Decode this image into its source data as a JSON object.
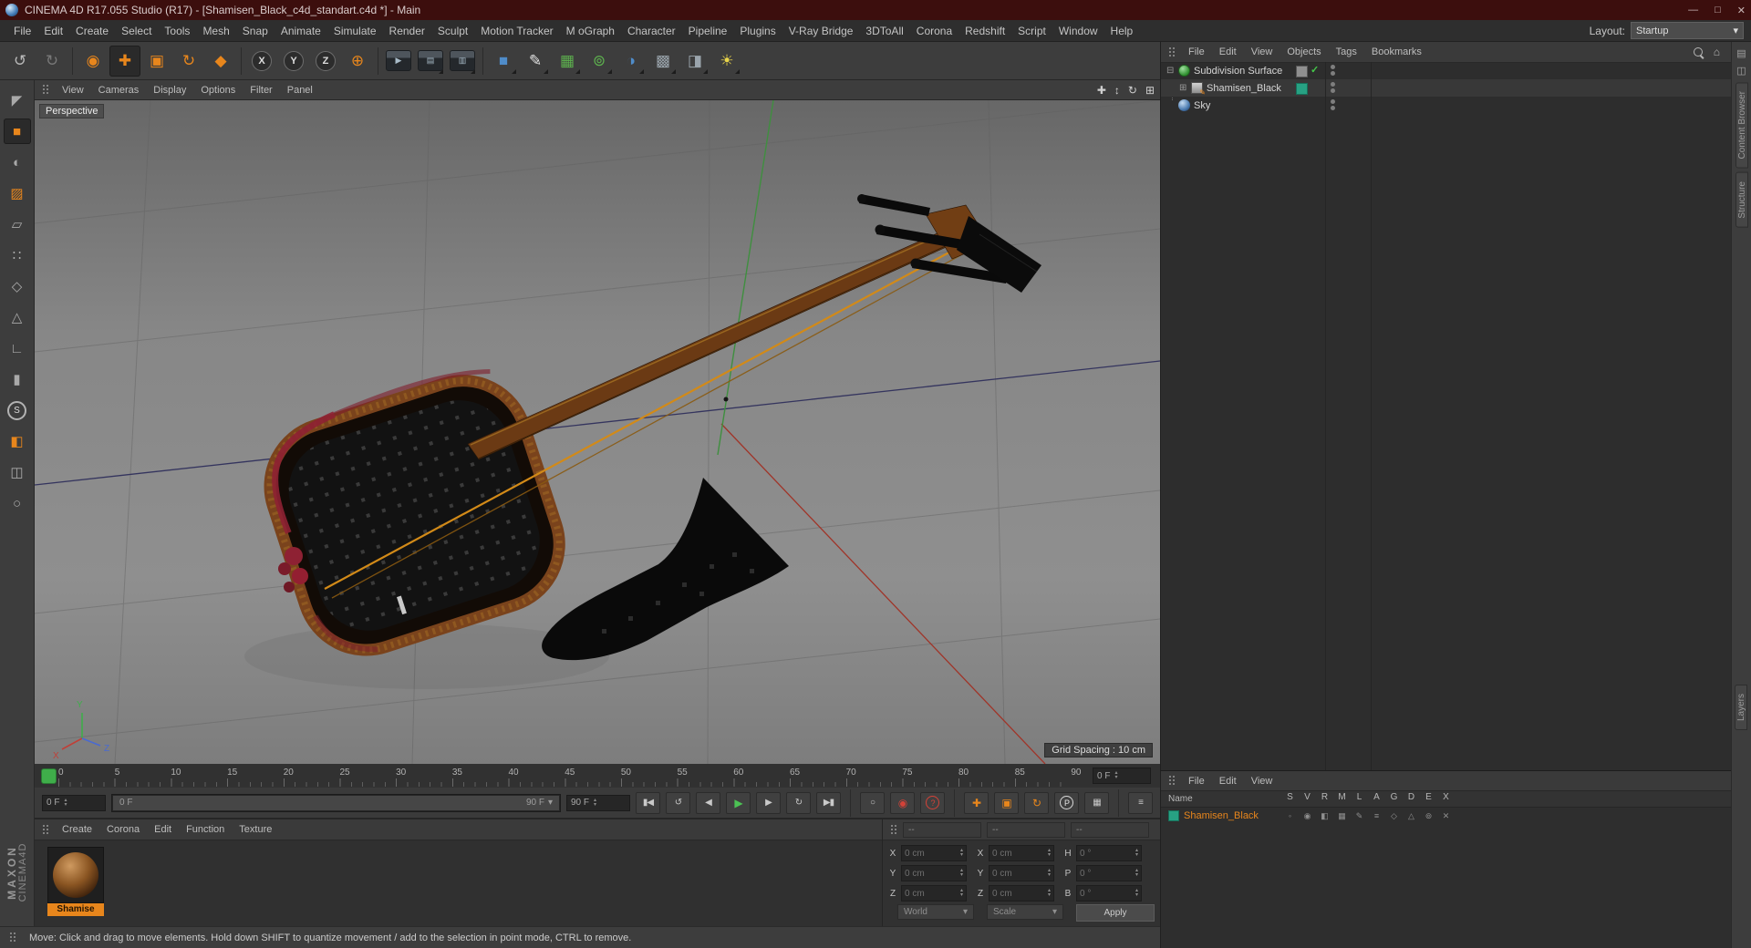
{
  "accent": "#e8861c",
  "title_bar": {
    "title": "CINEMA 4D R17.055 Studio (R17) - [Shamisen_Black_c4d_standart.c4d *] - Main"
  },
  "menu_bar": {
    "items": [
      "File",
      "Edit",
      "Create",
      "Select",
      "Tools",
      "Mesh",
      "Snap",
      "Animate",
      "Simulate",
      "Render",
      "Sculpt",
      "Motion Tracker",
      "M oGraph",
      "Character",
      "Pipeline",
      "Plugins",
      "V-Ray Bridge",
      "3DToAll",
      "Corona",
      "Redshift",
      "Script",
      "Window",
      "Help"
    ],
    "layout_label": "Layout:",
    "layout_value": "Startup"
  },
  "viewport": {
    "menu": [
      "View",
      "Cameras",
      "Display",
      "Options",
      "Filter",
      "Panel"
    ],
    "camera_label": "Perspective",
    "grid_label": "Grid Spacing : 10 cm",
    "axis": {
      "x": "X",
      "y": "Y",
      "z": "Z"
    }
  },
  "timeline": {
    "ticks": [
      "0",
      "5",
      "10",
      "15",
      "20",
      "25",
      "30",
      "35",
      "40",
      "45",
      "50",
      "55",
      "60",
      "65",
      "70",
      "75",
      "80",
      "85",
      "90"
    ],
    "current": "0 F",
    "range_start": "0 F",
    "range_end": "90 F",
    "end": "90 F"
  },
  "materials": {
    "menu": [
      "Create",
      "Corona",
      "Edit",
      "Function",
      "Texture"
    ],
    "items": [
      {
        "name": "Shamise"
      }
    ]
  },
  "coordinates": {
    "headers": [
      "--",
      "--",
      "--"
    ],
    "fields": [
      {
        "l": "X",
        "v": "0 cm"
      },
      {
        "l": "X",
        "v": "0 cm"
      },
      {
        "l": "H",
        "v": "0 °"
      },
      {
        "l": "Y",
        "v": "0 cm"
      },
      {
        "l": "Y",
        "v": "0 cm"
      },
      {
        "l": "P",
        "v": "0 °"
      },
      {
        "l": "Z",
        "v": "0 cm"
      },
      {
        "l": "Z",
        "v": "0 cm"
      },
      {
        "l": "B",
        "v": "0 °"
      }
    ],
    "world": "World",
    "scale": "Scale",
    "apply": "Apply"
  },
  "object_manager": {
    "menu": [
      "File",
      "Edit",
      "View",
      "Objects",
      "Tags",
      "Bookmarks"
    ],
    "objects": [
      {
        "name": "Subdivision Surface"
      },
      {
        "name": "Shamisen_Black"
      },
      {
        "name": "Sky"
      }
    ]
  },
  "layers_panel": {
    "menu": [
      "File",
      "Edit",
      "View"
    ],
    "name_header": "Name",
    "columns": [
      "S",
      "V",
      "R",
      "M",
      "L",
      "A",
      "G",
      "D",
      "E",
      "X"
    ],
    "row_icons": [
      "◦",
      "◉",
      "◧",
      "▦",
      "✎",
      "≡",
      "◇",
      "△",
      "⊚",
      "✕"
    ],
    "rows": [
      {
        "name": "Shamisen_Black"
      }
    ]
  },
  "status_bar": {
    "text": "Move: Click and drag to move elements. Hold down SHIFT to quantize movement / add to the selection in point mode, CTRL to remove."
  },
  "branding": {
    "line1": "MAXON",
    "line2": "CINEMA4D"
  },
  "side_tabs": {
    "top": [
      "Content Browser",
      "Structure"
    ],
    "bottom": [
      "Layers"
    ]
  },
  "icons": {
    "min": "—",
    "max": "□",
    "close": "✕",
    "arrow_down": "▾",
    "up": "▴",
    "down": "▾",
    "undo": "↺",
    "redo": "↻",
    "select": "◉",
    "move": "✚",
    "scale": "▣",
    "rotate": "↻",
    "last_tool": "◆",
    "x": "X",
    "y": "Y",
    "z": "Z",
    "coords": "⊕",
    "render_view": "▶",
    "render_settings": "▤",
    "render_queue": "▥",
    "cube": "■",
    "pen": "✎",
    "subdiv": "▦",
    "cloner": "⊚",
    "deformer": "◑",
    "floor": "▩",
    "camera": "◨",
    "light": "☀",
    "make_editable": "◤",
    "model_mode": "■",
    "texture_mode": "◐",
    "uv_mode": "▨",
    "workplane": "▱",
    "points": "∷",
    "edges": "◇",
    "polygons": "△",
    "axis": "∟",
    "viewport_nav": "▮",
    "snap": "S",
    "paint": "◧",
    "lock": "◫",
    "ring": "○",
    "pan": "✚",
    "dolly": "↕",
    "orbit": "↻",
    "vp_toggle": "⊞",
    "first": "▮◀",
    "prev_key": "↺",
    "prev": "◀",
    "play": "▶",
    "next": "▶",
    "next_key": "↻",
    "last": "▶▮",
    "sound": "○",
    "record": "◉",
    "autokey": "?",
    "key_pos": "✚",
    "key_scale": "▣",
    "key_rot": "↻",
    "key_param": "P",
    "key_point": "▦",
    "anim_layout": "≡",
    "home": "⌂",
    "expander_open": "⊟",
    "expander_closed": "⊞",
    "check": "✓",
    "strip_icon1": "▤",
    "strip_icon2": "◫"
  }
}
